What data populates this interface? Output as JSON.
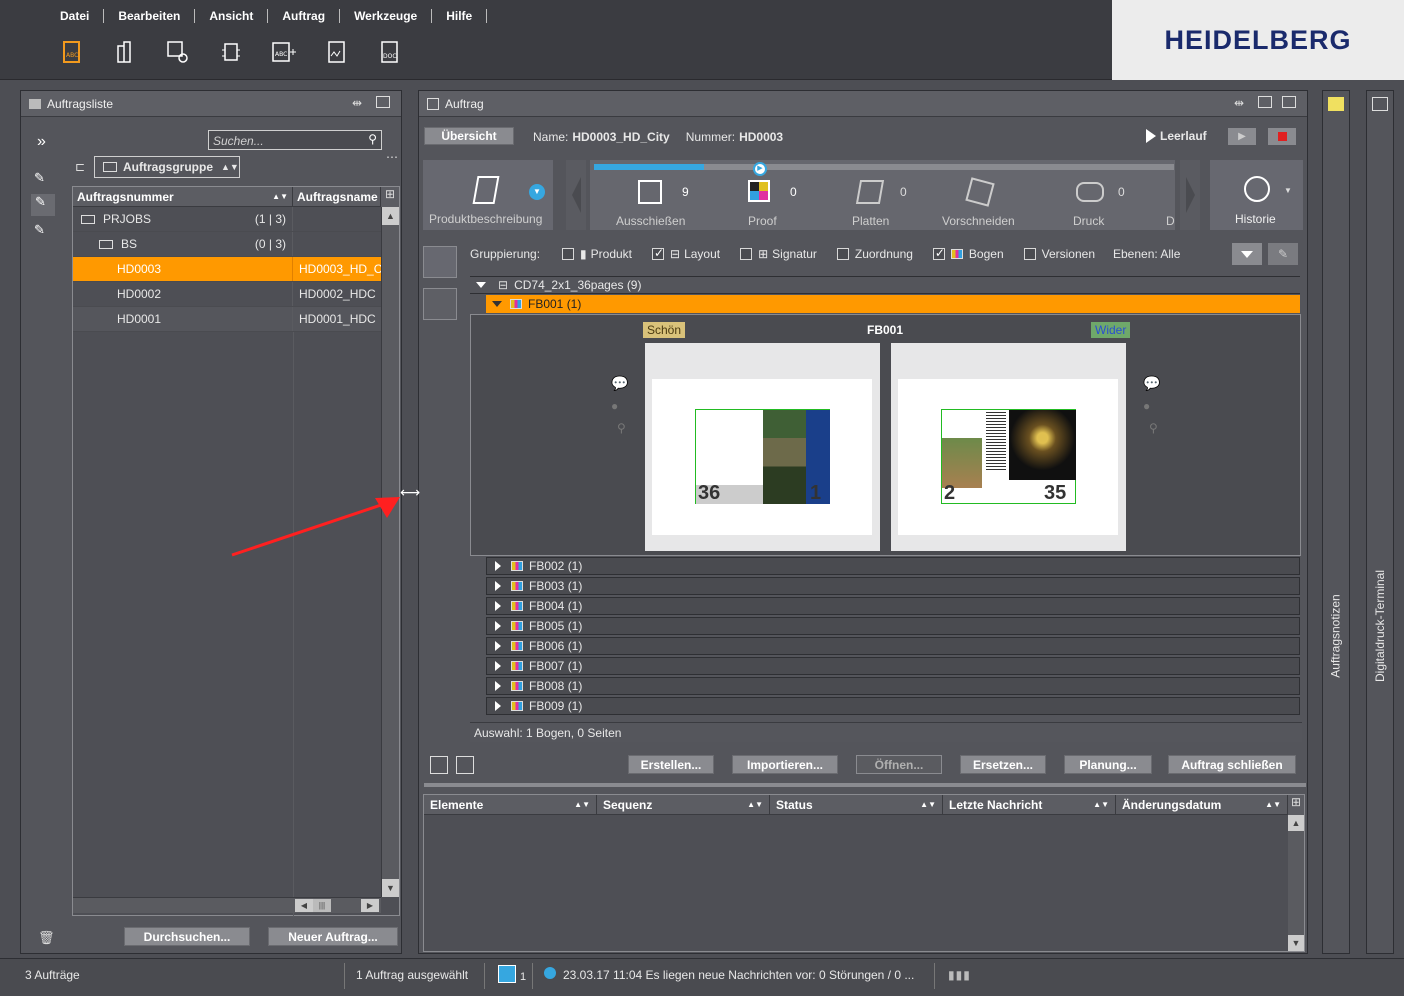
{
  "menu": [
    "Datei",
    "Bearbeiten",
    "Ansicht",
    "Auftrag",
    "Werkzeuge",
    "Hilfe"
  ],
  "logo": "HEIDELBERG",
  "left_panel": {
    "title": "Auftragsliste",
    "search_placeholder": "Suchen...",
    "group_label": "Auftragsgruppe",
    "columns": [
      "Auftragsnummer",
      "Auftragsname"
    ],
    "tree": [
      {
        "label": "PRJOBS",
        "count": "(1 | 3)"
      },
      {
        "label": "BS",
        "count": "(0 | 3)"
      }
    ],
    "rows": [
      {
        "number": "HD0003",
        "name": "HD0003_HD_C"
      },
      {
        "number": "HD0002",
        "name": "HD0002_HDC"
      },
      {
        "number": "HD0001",
        "name": "HD0001_HDC"
      }
    ],
    "buttons": {
      "browse": "Durchsuchen...",
      "new_job": "Neuer Auftrag..."
    }
  },
  "job_panel": {
    "title": "Auftrag",
    "overview_tab": "Übersicht",
    "name_label": "Name:",
    "name_value": "HD0003_HD_City",
    "number_label": "Nummer:",
    "number_value": "HD0003",
    "run_label": "Leerlauf",
    "product_step": "Produktbeschreibung",
    "steps": [
      {
        "label": "Ausschießen",
        "count": "9"
      },
      {
        "label": "Proof",
        "count": "0"
      },
      {
        "label": "Platten",
        "count": "0"
      },
      {
        "label": "Vorschneiden",
        "count": "0"
      },
      {
        "label": "Druck",
        "count": "0"
      },
      {
        "label": "D",
        "count": ""
      }
    ],
    "history": "Historie",
    "grouping": {
      "label": "Gruppierung:",
      "options": [
        {
          "label": "Produkt",
          "checked": false
        },
        {
          "label": "Layout",
          "checked": true
        },
        {
          "label": "Signatur",
          "checked": false
        },
        {
          "label": "Zuordnung",
          "checked": false
        },
        {
          "label": "Bogen",
          "checked": true
        },
        {
          "label": "Versionen",
          "checked": false
        }
      ],
      "levels": "Ebenen: Alle"
    },
    "layout_node": "CD74_2x1_36pages (9)",
    "selected_sheet": "FB001 (1)",
    "sheet_title": "FB001",
    "front_label": "Schön",
    "back_label": "Wider",
    "front_pages": {
      "left": "36",
      "right": "1"
    },
    "back_pages": {
      "left": "2",
      "right": "35"
    },
    "sheets": [
      "FB002 (1)",
      "FB003 (1)",
      "FB004 (1)",
      "FB005 (1)",
      "FB006 (1)",
      "FB007 (1)",
      "FB008 (1)",
      "FB009 (1)"
    ],
    "selection": "Auswahl:  1 Bogen,  0 Seiten",
    "actions": [
      "Erstellen...",
      "Importieren...",
      "Öffnen...",
      "Ersetzen...",
      "Planung...",
      "Auftrag schließen"
    ],
    "table_columns": [
      "Elemente",
      "Sequenz",
      "Status",
      "Letzte Nachricht",
      "Änderungsdatum"
    ]
  },
  "side_tabs": [
    "Auftragsnotizen",
    "Digitaldruck-Terminal"
  ],
  "status": {
    "jobs": "3 Aufträge",
    "selected": "1 Auftrag ausgewählt",
    "feed_count": "1",
    "message": "23.03.17 11:04  Es liegen neue Nachrichten vor: 0 Störungen / 0 ..."
  },
  "colors": {
    "accent": "#ff9900",
    "schoen": "#d9c27a",
    "wider": "#6fa86a",
    "stripe": "#36a7e0"
  }
}
